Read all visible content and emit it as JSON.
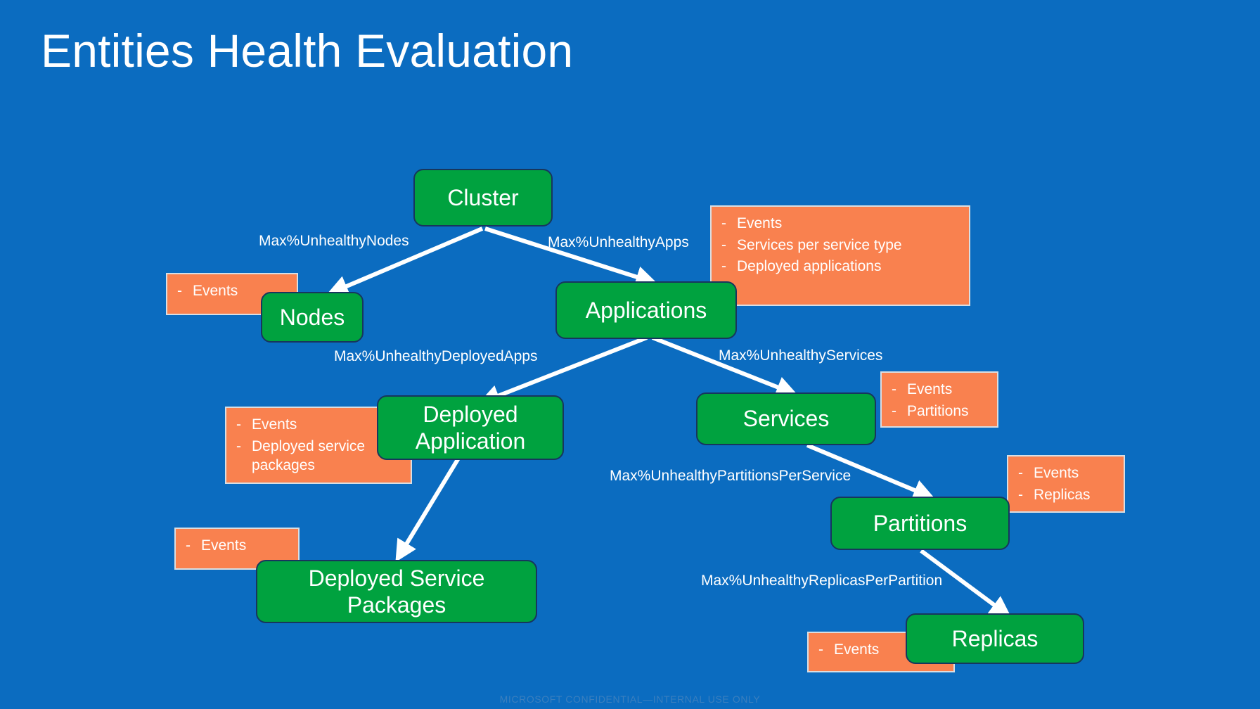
{
  "slide": {
    "title": "Entities Health Evaluation",
    "footer": "MICROSOFT CONFIDENTIAL—INTERNAL USE ONLY",
    "background_color": "#0B6CC0",
    "entity_color": "#00A23F",
    "entity_border_color": "#17365D",
    "callout_color": "#F9814F",
    "callout_border_color": "#D9DEE3",
    "text_color": "#FFFFFF",
    "footer_color": "#3B7FBE"
  },
  "entities": [
    {
      "id": "cluster",
      "label": "Cluster"
    },
    {
      "id": "nodes",
      "label": "Nodes"
    },
    {
      "id": "applications",
      "label": "Applications"
    },
    {
      "id": "deployed-application",
      "label": "Deployed Application"
    },
    {
      "id": "services",
      "label": "Services"
    },
    {
      "id": "deployed-service-packages",
      "label": "Deployed Service Packages"
    },
    {
      "id": "partitions",
      "label": "Partitions"
    },
    {
      "id": "replicas",
      "label": "Replicas"
    }
  ],
  "edges": [
    {
      "id": "cluster-nodes",
      "from": "Cluster",
      "to": "Nodes",
      "label": "Max%UnhealthyNodes"
    },
    {
      "id": "cluster-applications",
      "from": "Cluster",
      "to": "Applications",
      "label": "Max%UnhealthyApps"
    },
    {
      "id": "applications-deployedapp",
      "from": "Applications",
      "to": "Deployed Application",
      "label": "Max%UnhealthyDeployedApps"
    },
    {
      "id": "applications-services",
      "from": "Applications",
      "to": "Services",
      "label": "Max%UnhealthyServices"
    },
    {
      "id": "services-partitions",
      "from": "Services",
      "to": "Partitions",
      "label": "Max%UnhealthyPartitionsPerService"
    },
    {
      "id": "partitions-replicas",
      "from": "Partitions",
      "to": "Replicas",
      "label": "Max%UnhealthyReplicasPerPartition"
    },
    {
      "id": "deployedapp-packages",
      "from": "Deployed Application",
      "to": "Deployed Service Packages",
      "label": ""
    }
  ],
  "callouts": [
    {
      "id": "nodes-callout",
      "for": "Nodes",
      "items": [
        "Events"
      ]
    },
    {
      "id": "applications-callout",
      "for": "Applications",
      "items": [
        "Events",
        "Services per service type",
        "Deployed applications"
      ]
    },
    {
      "id": "deployedapp-callout",
      "for": "Deployed Application",
      "items": [
        "Events",
        "Deployed service packages"
      ]
    },
    {
      "id": "packages-callout",
      "for": "Deployed Service Packages",
      "items": [
        "Events"
      ]
    },
    {
      "id": "services-callout",
      "for": "Services",
      "items": [
        "Events",
        "Partitions"
      ]
    },
    {
      "id": "partitions-callout",
      "for": "Partitions",
      "items": [
        "Events",
        "Replicas"
      ]
    },
    {
      "id": "replicas-callout",
      "for": "Replicas",
      "items": [
        "Events"
      ]
    }
  ]
}
